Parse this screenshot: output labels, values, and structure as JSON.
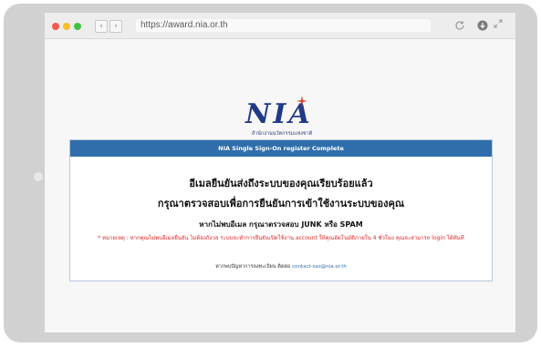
{
  "browser": {
    "url": "https://award.nia.or.th",
    "back_icon": "‹",
    "forward_icon": "›"
  },
  "logo": {
    "text": "NIA",
    "subtitle": "สำนักงานนวัตกรรมแห่งชาติ"
  },
  "panel": {
    "header": "NIA Single Sign-On register Complete",
    "line1": "อีเมลยืนยันส่งถึงระบบของคุณเรียบร้อยแล้ว",
    "line2": "กรุณาตรวจสอบเพื่อการยืนยันการเข้าใช้งานระบบของคุณ",
    "line3": "หากไม่พบอีเมล กรุณาตรวจสอบ JUNK หรือ SPAM",
    "note": "* หมายเหตุ : หากคุณไม่พบอีเมลยืนยัน ไม่ต้องกังวล ระบบจะทำการยืนยันเปิดใช้งาน account ให้คุณอัตโนมัติภายใน 4 ชั่วโมง คุณจะสามารถ login ได้ทันที",
    "contact_text": "หากพบปัญหาการลงทะเบียน ติดต่อ",
    "contact_email": "contact-sso@nia.or.th"
  },
  "colors": {
    "header_bg": "#2f6eaa",
    "note_red": "#e02525",
    "logo_blue": "#213a87",
    "logo_star": "#e23b2a"
  }
}
